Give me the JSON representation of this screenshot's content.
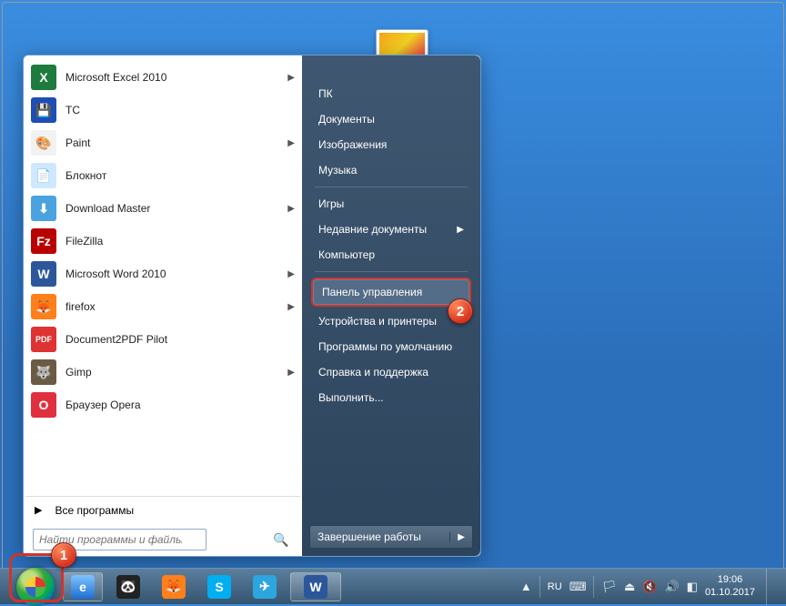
{
  "programs": [
    {
      "label": "Microsoft Excel 2010",
      "icon_bg": "#1f7a3e",
      "icon_txt": "X",
      "arrow": true
    },
    {
      "label": "TC",
      "icon_bg": "#1e4db3",
      "icon_txt": "💾",
      "arrow": false
    },
    {
      "label": "Paint",
      "icon_bg": "#f2f2f2",
      "icon_txt": "🎨",
      "arrow": true
    },
    {
      "label": "Блокнот",
      "icon_bg": "#cfe8ff",
      "icon_txt": "📄",
      "arrow": false
    },
    {
      "label": "Download Master",
      "icon_bg": "#4aa3df",
      "icon_txt": "⬇",
      "arrow": true
    },
    {
      "label": "FileZilla",
      "icon_bg": "#b90000",
      "icon_txt": "Fz",
      "arrow": false
    },
    {
      "label": "Microsoft Word 2010",
      "icon_bg": "#2b579a",
      "icon_txt": "W",
      "arrow": true
    },
    {
      "label": "firefox",
      "icon_bg": "#ff7f1a",
      "icon_txt": "🦊",
      "arrow": true
    },
    {
      "label": "Document2PDF Pilot",
      "icon_bg": "#d33",
      "icon_txt": "PDF",
      "arrow": false
    },
    {
      "label": "Gimp",
      "icon_bg": "#6b5b45",
      "icon_txt": "🐺",
      "arrow": true
    },
    {
      "label": "Браузер Opera",
      "icon_bg": "#e03040",
      "icon_txt": "O",
      "arrow": false
    }
  ],
  "all_programs_label": "Все программы",
  "search_placeholder": "Найти программы и файлы",
  "right_items": [
    {
      "label": "ПК",
      "type": "item"
    },
    {
      "label": "Документы",
      "type": "item"
    },
    {
      "label": "Изображения",
      "type": "item"
    },
    {
      "label": "Музыка",
      "type": "item"
    },
    {
      "type": "sep"
    },
    {
      "label": "Игры",
      "type": "item"
    },
    {
      "label": "Недавние документы",
      "type": "item",
      "arrow": true
    },
    {
      "label": "Компьютер",
      "type": "item"
    },
    {
      "type": "sep"
    },
    {
      "label": "Панель управления",
      "type": "item",
      "highlight": true
    },
    {
      "label": "Устройства и принтеры",
      "type": "item"
    },
    {
      "label": "Программы по умолчанию",
      "type": "item"
    },
    {
      "label": "Справка и поддержка",
      "type": "item"
    },
    {
      "label": "Выполнить...",
      "type": "item"
    }
  ],
  "shutdown_label": "Завершение работы",
  "taskbar": {
    "lang": "RU",
    "time": "19:06",
    "date": "01.10.2017",
    "pinned": [
      {
        "name": "ie",
        "bg": "linear-gradient(180deg,#7fc4ff,#1d6fd1)",
        "txt": "e",
        "active": true
      },
      {
        "name": "panda",
        "bg": "#222",
        "txt": "🐼"
      },
      {
        "name": "firefox",
        "bg": "#ff7f1a",
        "txt": "🦊"
      },
      {
        "name": "skype",
        "bg": "#00aff0",
        "txt": "S"
      },
      {
        "name": "telegram",
        "bg": "#2da5df",
        "txt": "✈"
      },
      {
        "name": "word",
        "bg": "#2b579a",
        "txt": "W",
        "wide": true
      }
    ]
  },
  "markers": {
    "one": "1",
    "two": "2"
  }
}
